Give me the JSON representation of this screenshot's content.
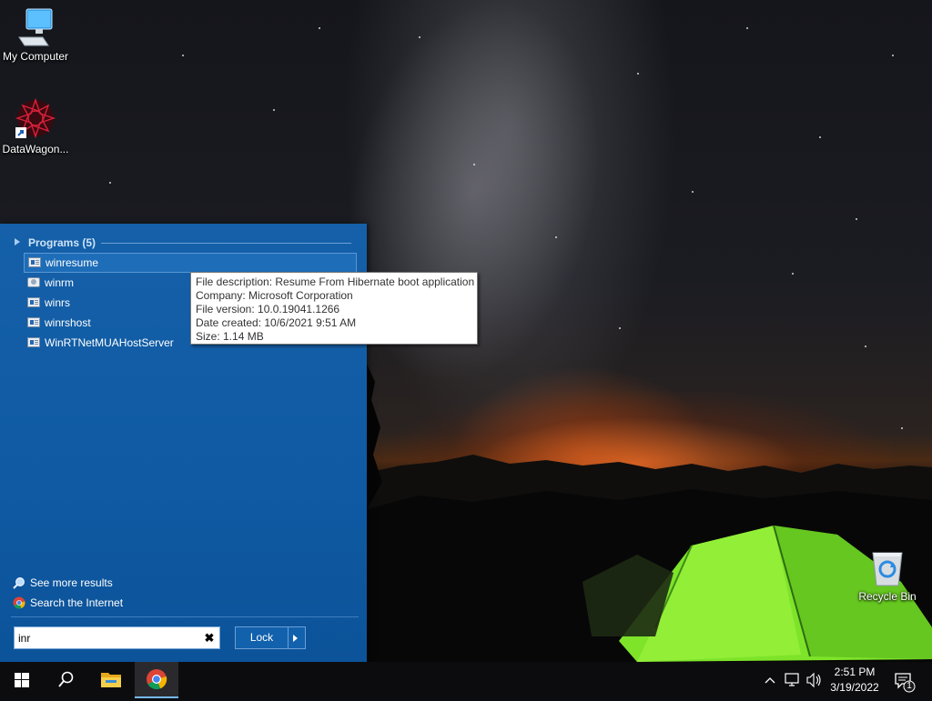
{
  "desktop": {
    "icons": [
      {
        "label": "My Computer",
        "icon": "computer-icon"
      },
      {
        "label": "DataWagon...",
        "icon": "datawagon-shortcut-icon"
      },
      {
        "label": "Recycle Bin",
        "icon": "recycle-bin-icon"
      }
    ]
  },
  "start_menu": {
    "programs_header": "Programs (5)",
    "programs": [
      {
        "label": "winresume",
        "selected": true
      },
      {
        "label": "winrm",
        "selected": false
      },
      {
        "label": "winrs",
        "selected": false
      },
      {
        "label": "winrshost",
        "selected": false
      },
      {
        "label": "WinRTNetMUAHostServer",
        "selected": false
      }
    ],
    "see_more": "See more results",
    "search_internet": "Search the Internet",
    "search_value": "inr",
    "lock_label": "Lock"
  },
  "tooltip": {
    "lines": [
      "File description: Resume From Hibernate boot application",
      "Company: Microsoft Corporation",
      "File version: 10.0.19041.1266",
      "Date created: 10/6/2021 9:51 AM",
      "Size: 1.14 MB"
    ]
  },
  "taskbar": {
    "buttons": [
      "windows-start-icon",
      "search-icon",
      "file-explorer-icon",
      "chrome-icon"
    ],
    "time": "2:51 PM",
    "date": "3/19/2022",
    "notification_count": "1"
  },
  "colors": {
    "start_menu_bg": "#1560a8",
    "taskbar_bg": "#0c0c0e",
    "tent_green": "#7ee42a"
  }
}
